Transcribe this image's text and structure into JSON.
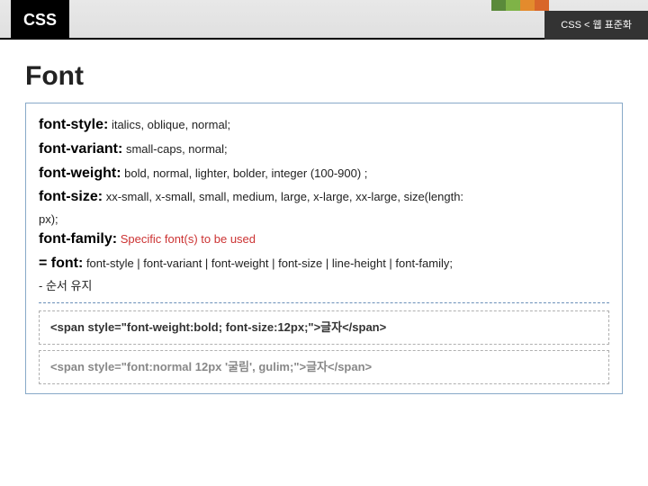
{
  "header": {
    "left": "CSS",
    "right": "CSS < 웹 표준화"
  },
  "title": "Font",
  "props": {
    "fs": {
      "name": "font-style:",
      "val": " italics, oblique, normal;"
    },
    "fv": {
      "name": "font-variant:",
      "val": " small-caps, normal;"
    },
    "fw": {
      "name": "font-weight:",
      "val": " bold, normal, lighter, bolder, integer (100-900) ;"
    },
    "fz": {
      "name": "font-size:",
      "val": " xx-small, x-small, small, medium, large, x-large, xx-large,  size(length:"
    },
    "fz_cont": "px);",
    "ff": {
      "name": "font-family:",
      "val": " Specific font(s) to be used"
    },
    "eq": {
      "name": "= font:",
      "val": " font-style | font-variant | font-weight | font-size | line-height | font-family;"
    },
    "note": "- 순서 유지"
  },
  "examples": {
    "ex1": "<span style=\"font-weight:bold; font-size:12px;\">글자</span>",
    "ex2": "<span style=\"font:normal 12px '굴림', gulim;\">글자</span>"
  }
}
